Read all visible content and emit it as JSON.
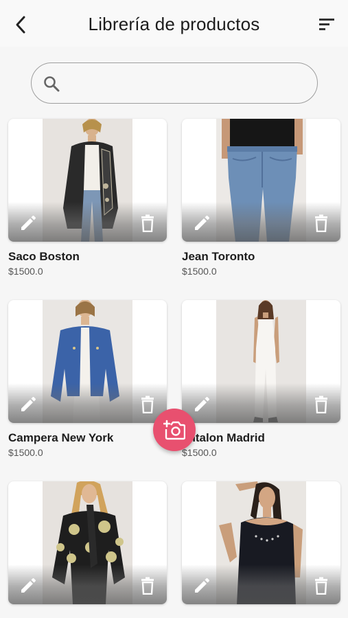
{
  "header": {
    "title": "Librería de productos",
    "back_icon": "chevron-left-icon",
    "sort_icon": "sort-icon"
  },
  "search": {
    "placeholder": "",
    "value": "",
    "icon": "search-icon"
  },
  "products": [
    {
      "name": "Saco Boston",
      "price": "$1500.0",
      "photo_bg": "#e7e3df"
    },
    {
      "name": "Jean Toronto",
      "price": "$1500.0",
      "photo_bg": "#ece9e6"
    },
    {
      "name": "Campera New York",
      "price": "$1500.0",
      "photo_bg": "#e9e6e3"
    },
    {
      "name": "antalon Madrid",
      "price": "$1500.0",
      "photo_bg": "#e8e5e2"
    },
    {
      "name": "",
      "price": "",
      "photo_bg": "#e6e2de"
    },
    {
      "name": "",
      "price": "",
      "photo_bg": "#e9e6e2"
    }
  ],
  "fab": {
    "icon": "add-photo-icon",
    "color": "#e8506f"
  },
  "colors": {
    "background": "#f6f6f6",
    "accent": "#e8506f"
  }
}
